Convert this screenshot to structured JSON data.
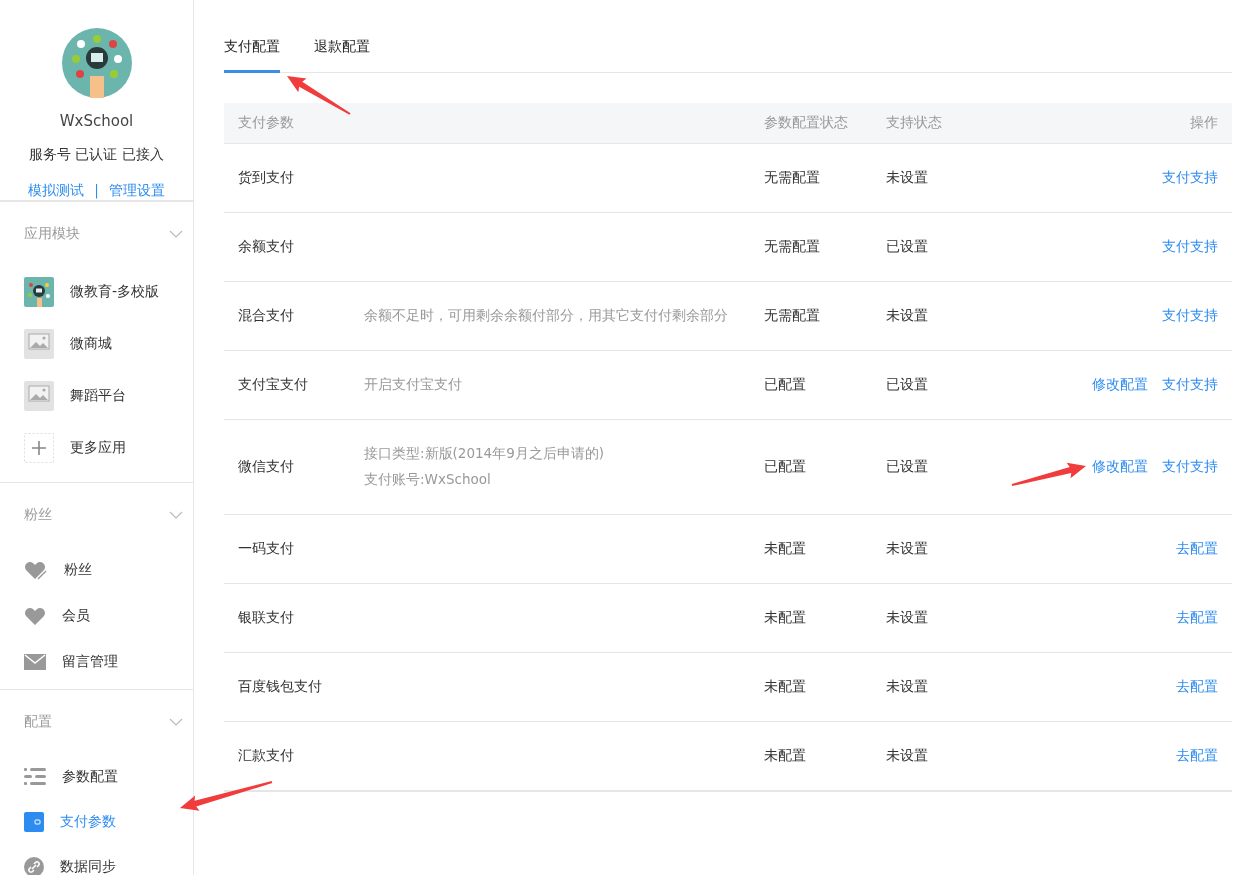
{
  "profile": {
    "name": "WxSchool",
    "status": "服务号 已认证 已接入",
    "links": [
      "模拟测试",
      "管理设置"
    ],
    "separator": "|"
  },
  "sidebar": [
    {
      "title": "应用模块",
      "expanded": true,
      "items": [
        {
          "label": "微教育-多校版",
          "kind": "app",
          "selected": false
        },
        {
          "label": "微商城",
          "kind": "app",
          "selected": false
        },
        {
          "label": "舞蹈平台",
          "kind": "app",
          "selected": false
        },
        {
          "label": "更多应用",
          "kind": "more",
          "selected": false
        }
      ]
    },
    {
      "title": "粉丝",
      "expanded": true,
      "items": [
        {
          "label": "粉丝",
          "kind": "fans",
          "selected": false
        },
        {
          "label": "会员",
          "kind": "members",
          "selected": false
        },
        {
          "label": "留言管理",
          "kind": "messages",
          "selected": false
        }
      ]
    },
    {
      "title": "配置",
      "expanded": true,
      "items": [
        {
          "label": "参数配置",
          "kind": "params",
          "selected": false
        },
        {
          "label": "支付参数",
          "kind": "payment",
          "selected": true
        },
        {
          "label": "数据同步",
          "kind": "sync",
          "selected": false
        }
      ]
    }
  ],
  "tabs": [
    {
      "label": "支付配置",
      "selected": true
    },
    {
      "label": "退款配置",
      "selected": false
    }
  ],
  "table": {
    "columns": {
      "name": "支付参数",
      "config_status": "参数配置状态",
      "support_status": "支持状态",
      "actions": "操作"
    },
    "rows": [
      {
        "name": "货到支付",
        "config_status": "无需配置",
        "support_status": "未设置",
        "actions": [
          "支付支持"
        ]
      },
      {
        "name": "余额支付",
        "config_status": "无需配置",
        "support_status": "已设置",
        "actions": [
          "支付支持"
        ]
      },
      {
        "name": "混合支付",
        "description": [
          "余额不足时，可用剩余余额付部分，用其它支付付剩余部分"
        ],
        "config_status": "无需配置",
        "support_status": "未设置",
        "actions": [
          "支付支持"
        ]
      },
      {
        "name": "支付宝支付",
        "description": [
          "开启支付宝支付"
        ],
        "config_status": "已配置",
        "support_status": "已设置",
        "actions": [
          "修改配置",
          "支付支持"
        ]
      },
      {
        "name": "微信支付",
        "description": [
          "接口类型:新版(2014年9月之后申请的)",
          "支付账号:WxSchool"
        ],
        "config_status": "已配置",
        "support_status": "已设置",
        "actions": [
          "修改配置",
          "支付支持"
        ]
      },
      {
        "name": "一码支付",
        "config_status": "未配置",
        "support_status": "未设置",
        "actions": [
          "去配置"
        ]
      },
      {
        "name": "银联支付",
        "config_status": "未配置",
        "support_status": "未设置",
        "actions": [
          "去配置"
        ]
      },
      {
        "name": "百度钱包支付",
        "config_status": "未配置",
        "support_status": "未设置",
        "actions": [
          "去配置"
        ]
      },
      {
        "name": "汇款支付",
        "config_status": "未配置",
        "support_status": "未设置",
        "actions": [
          "去配置"
        ]
      }
    ]
  }
}
